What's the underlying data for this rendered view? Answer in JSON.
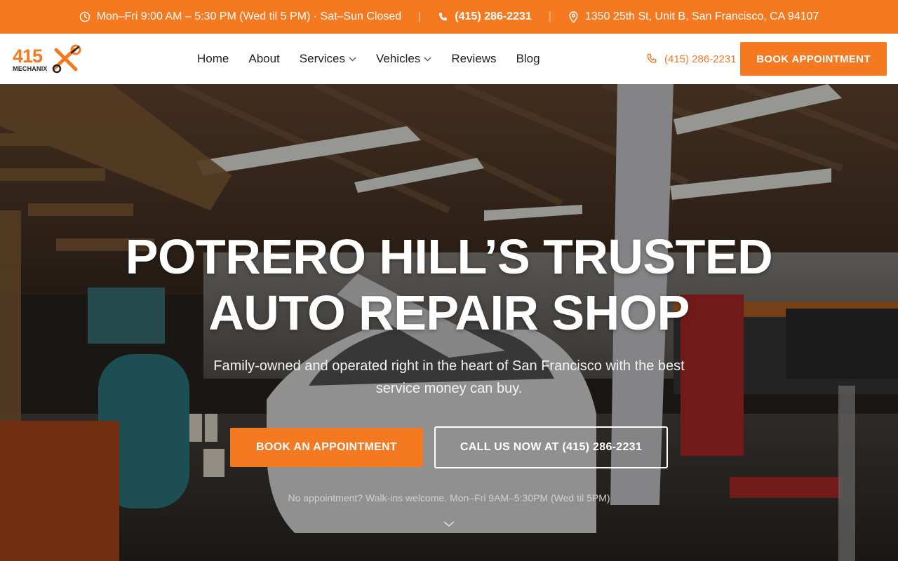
{
  "topbar": {
    "hours": "Mon–Fri 9:00 AM – 5:30 PM (Wed til 5 PM) · Sat–Sun Closed",
    "separator": "|",
    "phone": "(415) 286-2231",
    "address": "1350 25th St, Unit B, San Francisco, CA 94107",
    "icons": [
      "clock-icon",
      "phone-icon",
      "map-pin-icon"
    ]
  },
  "header": {
    "logo": {
      "number": "415",
      "word": "MECHANIX"
    },
    "nav": [
      {
        "label": "Home",
        "dropdown": false
      },
      {
        "label": "About",
        "dropdown": false
      },
      {
        "label": "Services",
        "dropdown": true
      },
      {
        "label": "Vehicles",
        "dropdown": true
      },
      {
        "label": "Reviews",
        "dropdown": false
      },
      {
        "label": "Blog",
        "dropdown": false
      }
    ],
    "phone": "(415) 286-2231",
    "book_label": "BOOK APPOINTMENT"
  },
  "hero": {
    "title_line1": "POTRERO HILL’S TRUSTED",
    "title_line2": "AUTO REPAIR SHOP",
    "subtitle": "Family-owned and operated right in the heart of San Francisco with the best service money can buy.",
    "primary_cta": "BOOK AN APPOINTMENT",
    "secondary_cta": "CALL US NOW AT (415) 286-2231",
    "note": "No appointment? Walk-ins welcome. Mon–Fri 9AM–5:30PM (Wed til 5PM)"
  },
  "colors": {
    "accent": "#f47920",
    "white": "#ffffff",
    "text_dark": "#222222"
  }
}
